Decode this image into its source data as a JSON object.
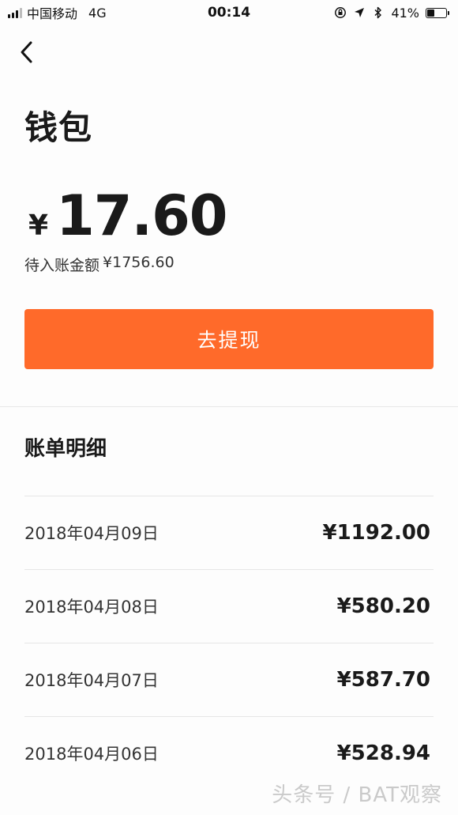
{
  "status_bar": {
    "carrier": "中国移动",
    "network": "4G",
    "time": "00:14",
    "battery_percent": "41%",
    "battery_level": 0.41,
    "icons": [
      "signal-icon",
      "orientation-lock-icon",
      "location-icon",
      "bluetooth-icon",
      "battery-icon"
    ]
  },
  "nav": {
    "back_icon": "back-arrow-icon"
  },
  "wallet": {
    "title": "钱包",
    "currency_symbol": "¥",
    "balance": "17.60",
    "pending_label": "待入账金额",
    "pending_value": "¥1756.60",
    "withdraw_label": "去提现"
  },
  "bills": {
    "title": "账单明细",
    "items": [
      {
        "date": "2018年04月09日",
        "amount": "¥1192.00"
      },
      {
        "date": "2018年04月08日",
        "amount": "¥580.20"
      },
      {
        "date": "2018年04月07日",
        "amount": "¥587.70"
      },
      {
        "date": "2018年04月06日",
        "amount": "¥528.94"
      }
    ]
  },
  "watermark": "头条号 / BAT观察",
  "colors": {
    "accent": "#ff6a2a",
    "text_primary": "#1a1a1a",
    "divider": "#e6e6e6"
  }
}
